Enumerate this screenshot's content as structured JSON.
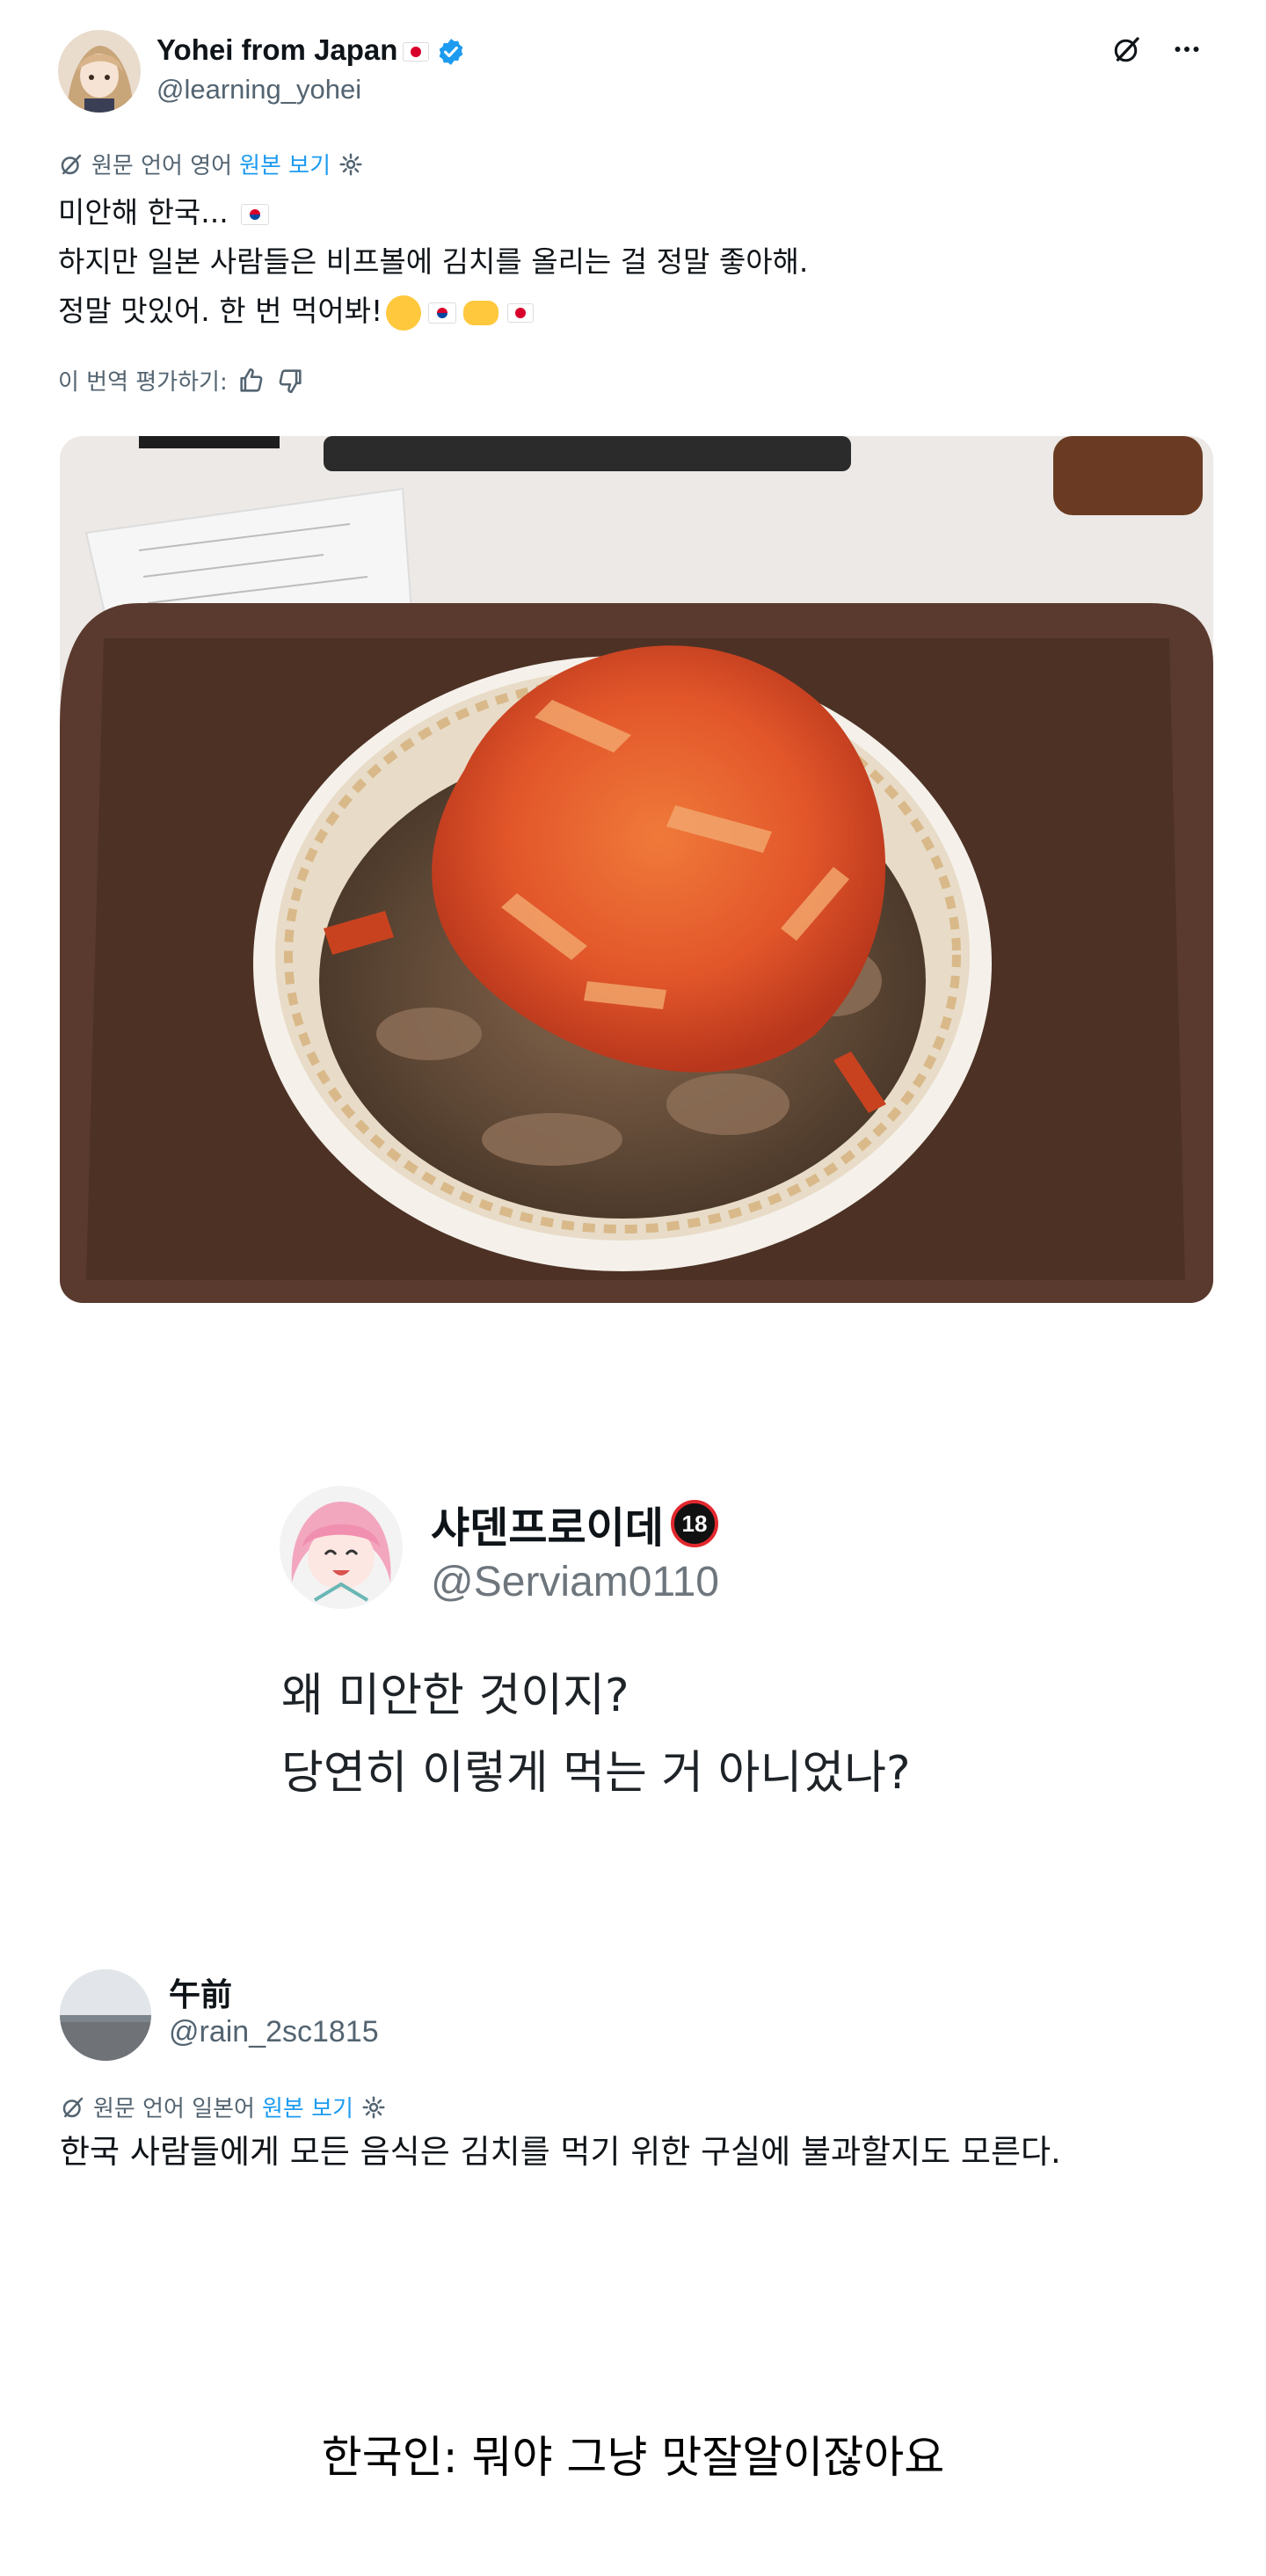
{
  "post1": {
    "display_name": "Yohei from Japan",
    "handle": "@learning_yohei",
    "translation_note": "원문 언어 영어",
    "show_original": "원본 보기",
    "text_lines": [
      "미안해 한국...",
      "하지만 일본 사람들은 비프볼에 김치를 올리는 걸 정말 좋아해.",
      "정말 맛있어. 한 번 먹어봐!"
    ],
    "rate_translation": "이 번역 평가하기:",
    "more_icon": "more-horizontal-icon",
    "grok_icon": "grok-icon"
  },
  "quote": {
    "display_name": "샤덴프로이데",
    "badge": "18",
    "handle": "@Serviam0110",
    "text_lines": [
      "왜 미안한 것이지?",
      "당연히 이렇게 먹는 거 아니었나?"
    ]
  },
  "post2": {
    "display_name": "午前",
    "handle": "@rain_2sc1815",
    "translation_note": "원문 언어 일본어",
    "show_original": "원본 보기",
    "text": "한국 사람들에게 모든 음식은 김치를 먹기 위한 구실에 불과할지도 모른다."
  },
  "caption": "한국인: 뭐야 그냥 맛잘알이잖아요",
  "colors": {
    "link": "#1d9bf0",
    "muted": "#536471",
    "text": "#0f1419",
    "tray": "#5a3a2e",
    "kimchi": "#e2562a"
  }
}
